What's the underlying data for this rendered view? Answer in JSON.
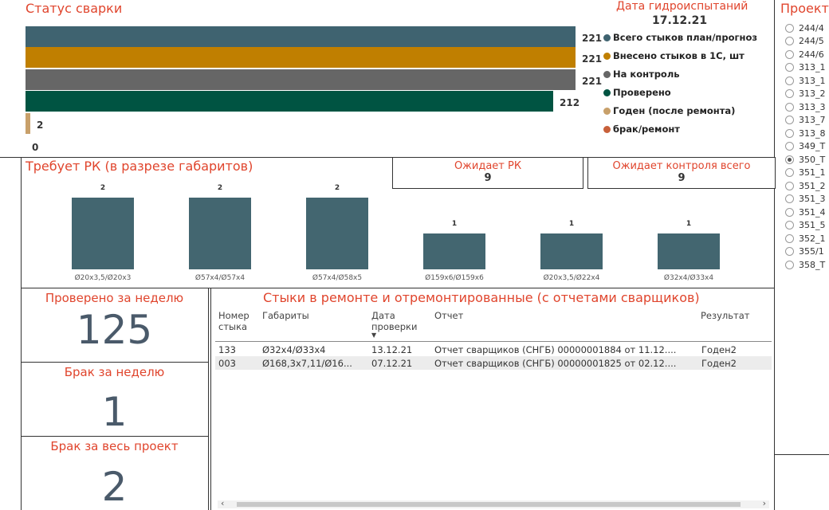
{
  "status": {
    "title": "Статус сварки",
    "hydro_title": "Дата гидроиспытаний",
    "hydro_date": "17.12.21",
    "bars": [
      {
        "label": "Всего стыков план/прогноз",
        "value": 221,
        "color": "#3f6370"
      },
      {
        "label": "Внесено стыков в 1С, шт",
        "value": 221,
        "color": "#c07f00"
      },
      {
        "label": "На контроль",
        "value": 221,
        "color": "#666666"
      },
      {
        "label": "Проверено",
        "value": 212,
        "color": "#005442"
      },
      {
        "label": "Годен (после ремонта)",
        "value": 2,
        "color": "#c8a06a"
      },
      {
        "label": "брак/ремонт",
        "value": 0,
        "color": "#c8603a"
      }
    ],
    "values_text": [
      "221",
      "221",
      "221",
      "212",
      "2",
      "0"
    ]
  },
  "rk": {
    "title": "Требует РК (в разрезе габаритов)",
    "awaiting_rk_label": "Ожидает РК",
    "awaiting_rk_value": "9",
    "awaiting_control_label": "Ожидает контроля всего",
    "awaiting_control_value": "9"
  },
  "chart_data": {
    "type": "bar",
    "title": "Требует РК (в разрезе габаритов)",
    "categories": [
      "Ø20x3,5/Ø20x3",
      "Ø57x4/Ø57x4",
      "Ø57x4/Ø58x5",
      "Ø159x6/Ø159x6",
      "Ø20x3,5/Ø22x4",
      "Ø32x4/Ø33x4"
    ],
    "values": [
      2,
      2,
      2,
      1,
      1,
      1
    ],
    "value_labels": [
      "2",
      "2",
      "2",
      "1",
      "1",
      "1"
    ],
    "color": "#436670",
    "ylim": [
      0,
      2
    ]
  },
  "cards": [
    {
      "title": "Проверено за неделю",
      "value": "125"
    },
    {
      "title": "Брак за неделю",
      "value": "1"
    },
    {
      "title": "Брак за весь проект",
      "value": "2"
    }
  ],
  "repairs": {
    "title": "Стыки в ремонте и отремонтированные (с отчетами сварщиков)",
    "headers": {
      "joint_no": "Номер стыка",
      "dims": "Габариты",
      "date": "Дата проверки",
      "report": "Отчет",
      "result": "Результат"
    },
    "rows": [
      {
        "joint_no": "133",
        "dims": "Ø32x4/Ø33x4",
        "date": "13.12.21",
        "report": "Отчет сварщиков (СНГБ) 00000001884 от 11.12....",
        "result": "Годен2"
      },
      {
        "joint_no": "003",
        "dims": "Ø168,3x7,11/Ø16...",
        "date": "07.12.21",
        "report": "Отчет сварщиков (СНГБ) 00000001825 от 02.12....",
        "result": "Годен2"
      }
    ]
  },
  "projects": {
    "title": "Проект",
    "items": [
      "244/4",
      "244/5",
      "244/6",
      "313_1",
      "313_1",
      "313_2",
      "313_3",
      "313_7",
      "313_8",
      "349_T",
      "350_T",
      "351_1",
      "351_2",
      "351_3",
      "351_4",
      "351_5",
      "352_1",
      "355/1",
      "358_T"
    ],
    "selected": "350_T"
  },
  "colors": {
    "accent_red": "#e0452d"
  }
}
